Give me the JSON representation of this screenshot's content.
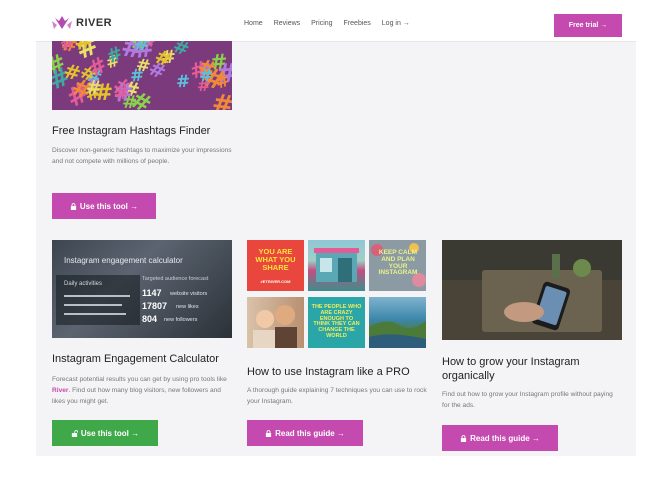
{
  "header": {
    "logo_text": "RIVER",
    "nav": [
      "Home",
      "Reviews",
      "Pricing",
      "Freebies",
      "Log in →"
    ],
    "cta": "Free trial →"
  },
  "cards": {
    "hashtags": {
      "title": "Free Instagram Hashtags Finder",
      "desc": "Discover non-generic hashtags to maximize your impressions and not compete with millions of people.",
      "button": "Use this tool →"
    },
    "calculator": {
      "image": {
        "heading": "Instagram engagement calculator",
        "panel_title": "Daily activities",
        "forecast_title": "Targeted audience forecast",
        "stats": [
          {
            "value": "1147",
            "label": "website visitors"
          },
          {
            "value": "17807",
            "label": "new likes"
          },
          {
            "value": "804",
            "label": "new followers"
          }
        ]
      },
      "title": "Instagram Engagement Calculator",
      "desc_before": "Forecast potential results you can get by using pro tools like ",
      "desc_brand": "River",
      "desc_after": ". Find out how many blog visitors, new followers and likes you might get.",
      "button": "Use this tool →"
    },
    "pro": {
      "tiles": {
        "t1": "YOU ARE WHAT YOU SHARE",
        "t1_small": "#ETRIVER.COM",
        "t3": "KEEP CALM AND PLAN YOUR INSTAGRAM",
        "t5": "THE PEOPLE WHO ARE CRAZY ENOUGH TO THINK THEY CAN CHANGE THE WORLD"
      },
      "title": "How to use Instagram like a PRO",
      "desc": "A thorough guide explaining 7 techniques you can use to rock your Instagram.",
      "button": "Read this guide →"
    },
    "grow": {
      "title": "How to grow your Instagram organically",
      "desc": "Find out how to grow your Instagram profile without paying for the ads.",
      "button": "Read this guide →"
    }
  },
  "colors": {
    "brand": "#c54aaf",
    "green": "#3fa94a",
    "background": "#f4f4f6"
  }
}
